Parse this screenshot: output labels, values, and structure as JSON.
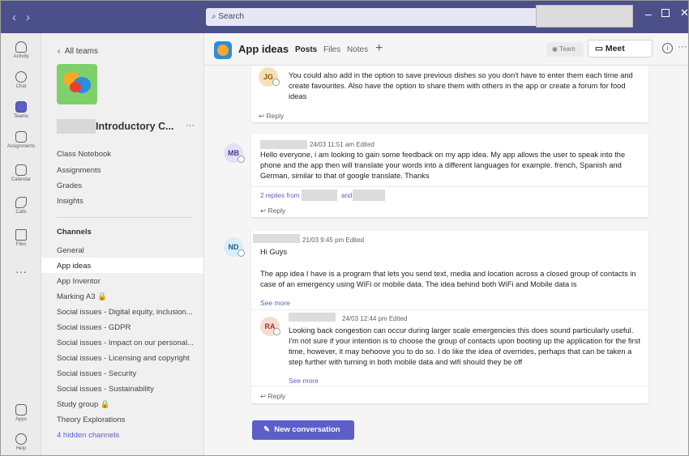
{
  "titlebar": {
    "search_placeholder": "Search",
    "more": "···",
    "minimize": "–",
    "close": "✕"
  },
  "rail": [
    {
      "label": "Activity"
    },
    {
      "label": "Chat"
    },
    {
      "label": "Teams"
    },
    {
      "label": "Assignments"
    },
    {
      "label": "Calendar"
    },
    {
      "label": "Calls"
    },
    {
      "label": "Files"
    },
    {
      "label": "Apps"
    },
    {
      "label": "Help"
    }
  ],
  "rail_more": "···",
  "team_panel": {
    "back_label": "All teams",
    "team_name": "Introductory C...",
    "team_more": "···",
    "links": [
      "Class Notebook",
      "Assignments",
      "Grades",
      "Insights"
    ],
    "channels_heading": "Channels",
    "channels": [
      "General",
      "App ideas",
      "App Inventor",
      "Marking A3 🔒",
      "Social issues - Digital equity, inclusion...",
      "Social issues - GDPR",
      "Social issues - Impact on our personal...",
      "Social issues - Licensing and copyright",
      "Social issues - Security",
      "Social issues - Sustainability",
      "Study group 🔒",
      "Theory Explorations"
    ],
    "hidden_channels": "4 hidden channels"
  },
  "header": {
    "channel_title": "App ideas",
    "tabs": [
      "Posts",
      "Files",
      "Notes"
    ],
    "add_tab": "+",
    "team_button": "Team",
    "meet_button": "Meet"
  },
  "posts": [
    {
      "avatar": "JG",
      "body": "You could also add in the option to save previous dishes so you don't have to enter them each time and create favourites. Also have the option to share them with others in the app or create a forum for food ideas",
      "reply": "Reply"
    },
    {
      "avatar": "MB",
      "meta": "24/03 11:51 am   Edited",
      "body": "Hello everyone, i am looking to gain some feedback on my app idea. My app allows the user to speak into the phone and the app then will translate your words into a different languages for example. french, Spanish and German,  similar to that of google translate. Thanks",
      "replies_from": "2 replies from",
      "and": "and",
      "reply": "Reply"
    },
    {
      "avatar": "ND",
      "meta": "21/03 9:45 pm   Edited",
      "greeting": "Hi Guys",
      "body": "The app idea I have is a program that lets you send text, media and location across a closed group of contacts in case of an emergency using WiFi or mobile data. The idea behind both WiFi and Mobile data is",
      "see_more": "See more",
      "nested": {
        "avatar": "RA",
        "meta": "24/03 12:44 pm   Edited",
        "body": "Looking back congestion can occur during larger scale emergencies this does sound particularly useful. I'm not sure if your intention is to choose the group of contacts upon booting up the application for the first time, however, it may behoove you to do so. I do like the idea of overrides, perhaps that can be taken a step further with turning in both mobile data and wifi should they be off",
        "see_more": "See more"
      },
      "reply": "Reply"
    }
  ],
  "new_conversation": "New conversation",
  "colors": {
    "brand": "#4b4f8a",
    "accent": "#5b5fc7"
  }
}
